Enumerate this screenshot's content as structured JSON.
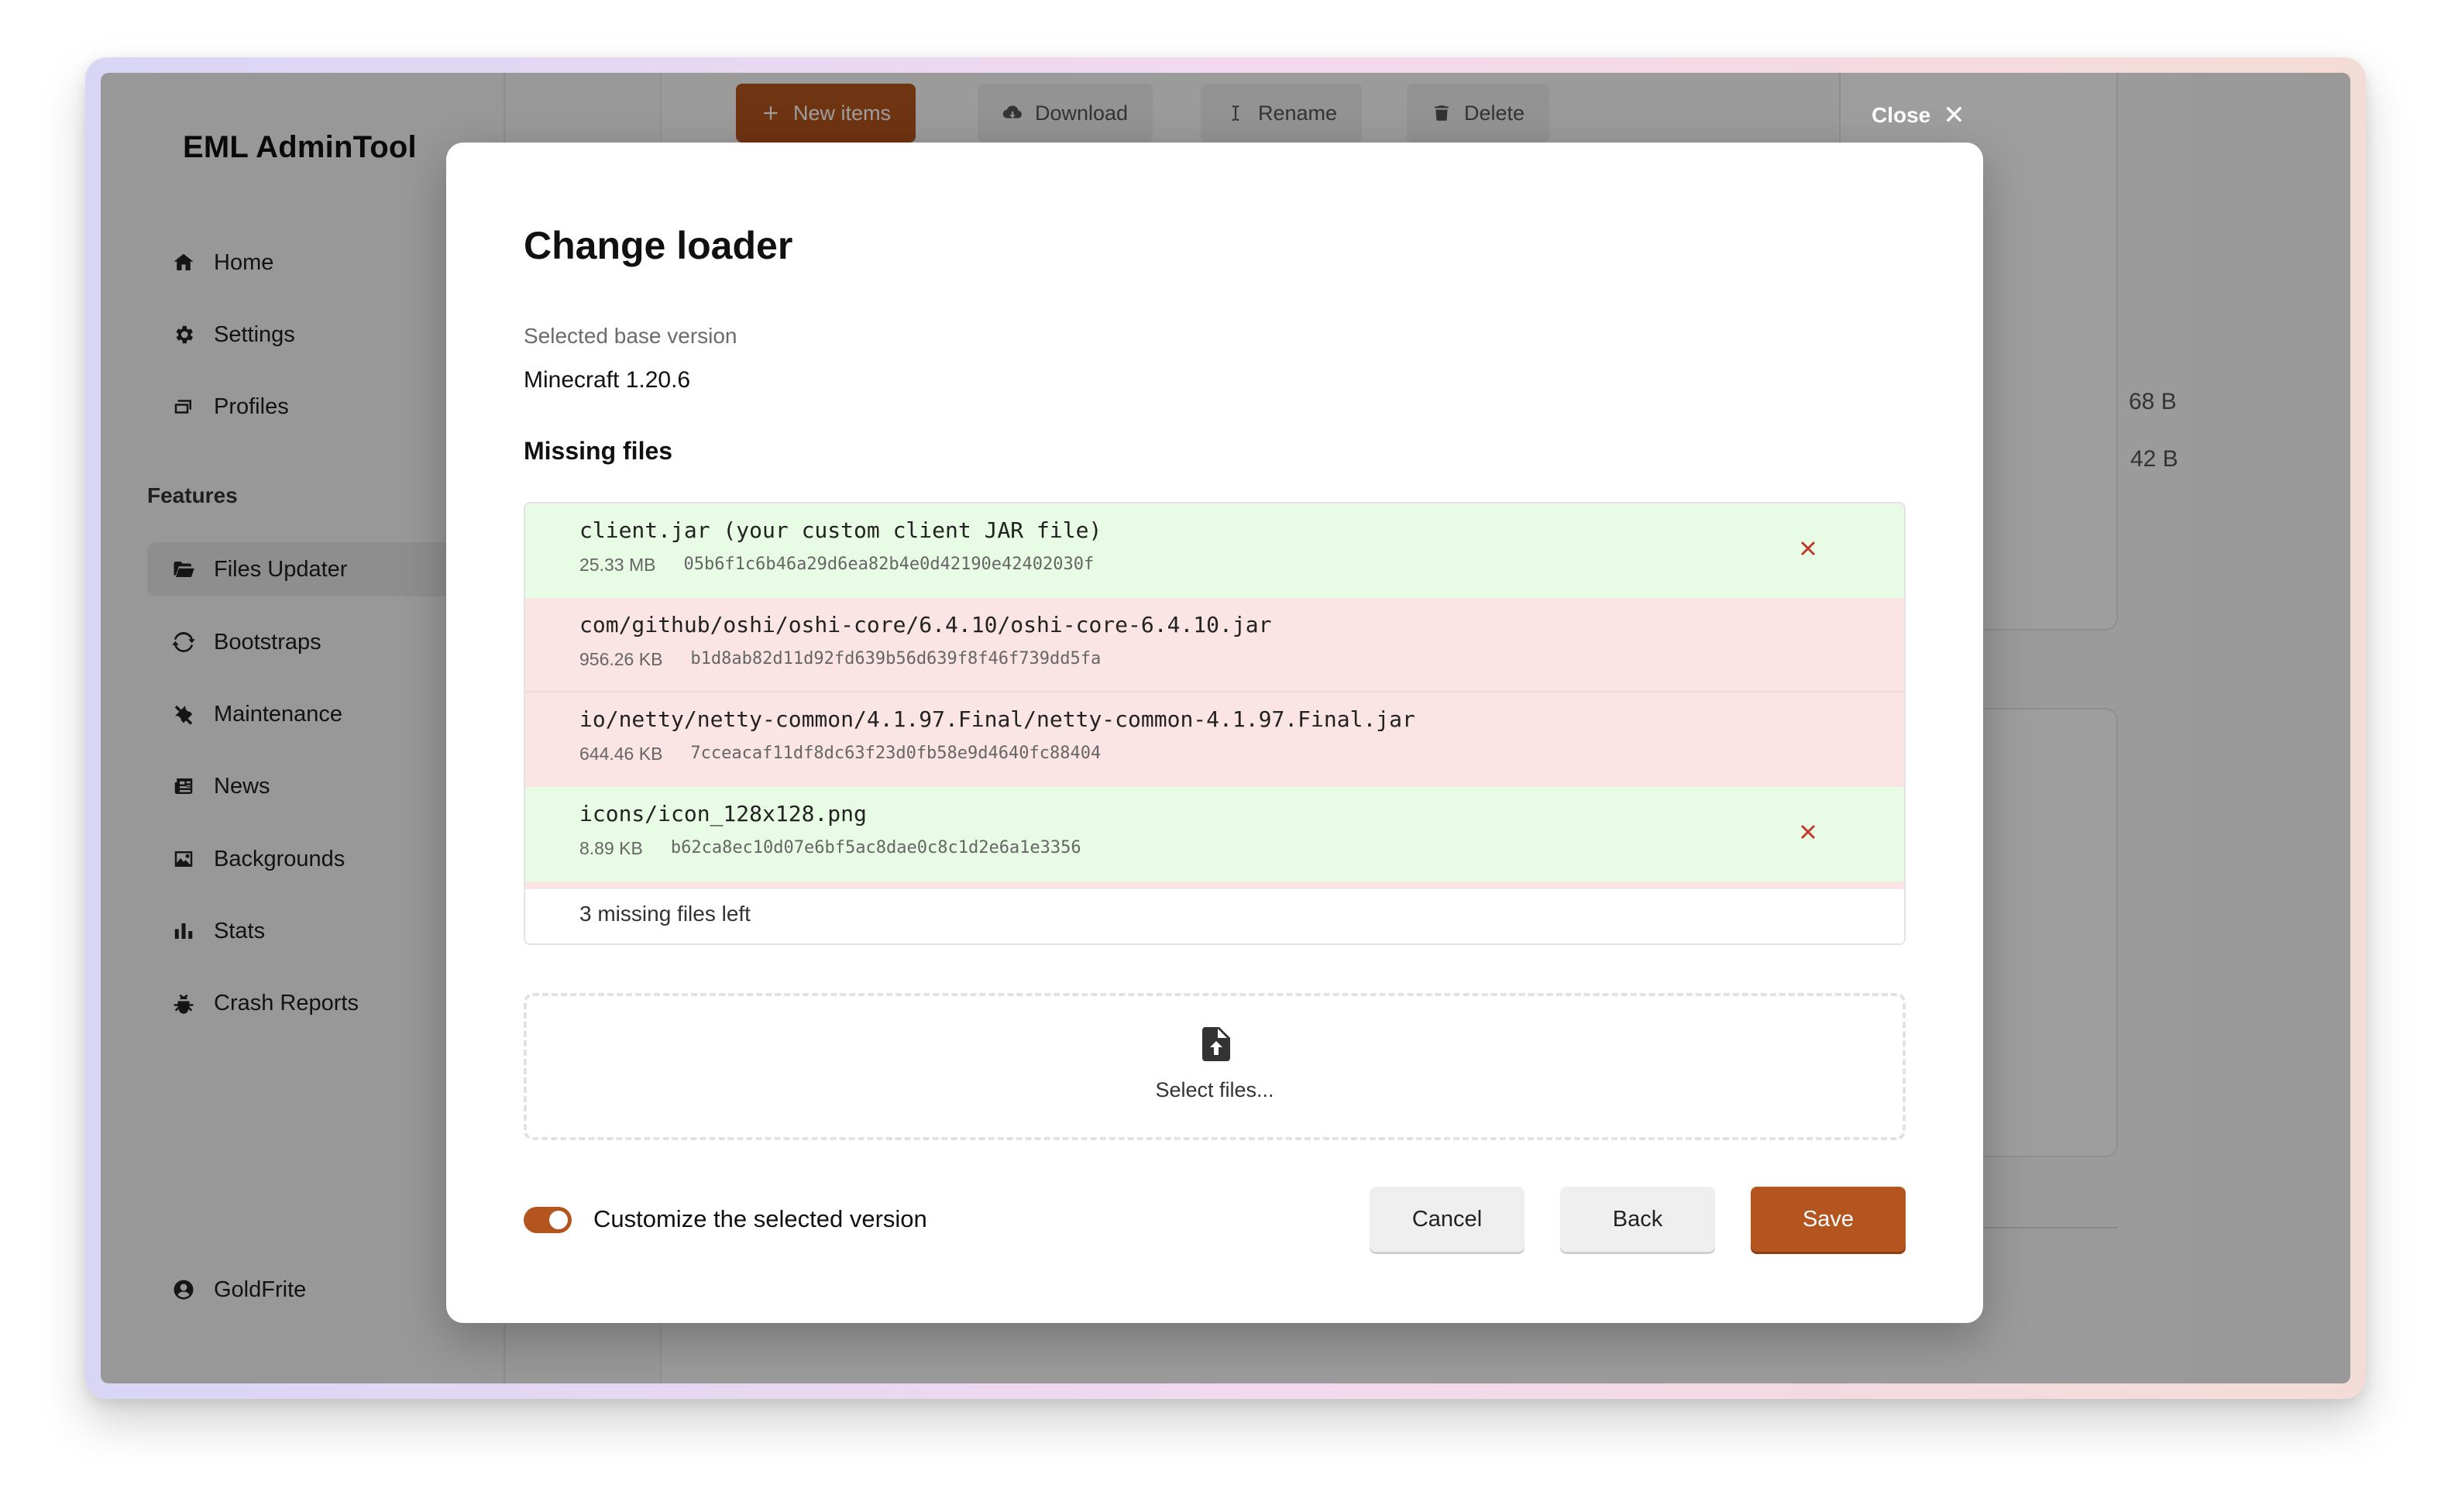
{
  "sidebar": {
    "app_title": "EML AdminTool",
    "nav": [
      {
        "label": "Home",
        "icon": "home-icon"
      },
      {
        "label": "Settings",
        "icon": "gear-icon"
      },
      {
        "label": "Profiles",
        "icon": "profiles-icon"
      }
    ],
    "features_label": "Features",
    "features": [
      {
        "label": "Files Updater",
        "icon": "folder-open-icon",
        "active": true
      },
      {
        "label": "Bootstraps",
        "icon": "refresh-icon"
      },
      {
        "label": "Maintenance",
        "icon": "tools-icon"
      },
      {
        "label": "News",
        "icon": "newspaper-icon"
      },
      {
        "label": "Backgrounds",
        "icon": "image-icon"
      },
      {
        "label": "Stats",
        "icon": "bar-chart-icon"
      },
      {
        "label": "Crash Reports",
        "icon": "bug-icon"
      }
    ],
    "user": {
      "name": "GoldFrite",
      "icon": "user-circle-icon"
    }
  },
  "toolbar": {
    "new_items": "New items",
    "download": "Download",
    "rename": "Rename",
    "delete": "Delete"
  },
  "background_sizes": [
    "68 B",
    "42 B"
  ],
  "close_label": "Close",
  "modal": {
    "title": "Change loader",
    "base_version_label": "Selected base version",
    "base_version_value": "Minecraft 1.20.6",
    "missing_files_title": "Missing files",
    "files": [
      {
        "name": "client.jar (your custom client JAR file)",
        "size": "25.33 MB",
        "hash": "05b6f1c6b46a29d6ea82b4e0d42190e42402030f",
        "status": "provided"
      },
      {
        "name": "com/github/oshi/oshi-core/6.4.10/oshi-core-6.4.10.jar",
        "size": "956.26 KB",
        "hash": "b1d8ab82d11d92fd639b56d639f8f46f739dd5fa",
        "status": "missing"
      },
      {
        "name": "io/netty/netty-common/4.1.97.Final/netty-common-4.1.97.Final.jar",
        "size": "644.46 KB",
        "hash": "7cceacaf11df8dc63f23d0fb58e9d4640fc88404",
        "status": "missing"
      },
      {
        "name": "icons/icon_128x128.png",
        "size": "8.89 KB",
        "hash": "b62ca8ec10d07e6bf5ac8dae0c8c1d2e6a1e3356",
        "status": "provided"
      }
    ],
    "missing_left": "3 missing files left",
    "select_files": "Select files...",
    "customize_label": "Customize the selected version",
    "customize_enabled": true,
    "cancel": "Cancel",
    "back": "Back",
    "save": "Save"
  },
  "colors": {
    "accent": "#b4541e",
    "ok_row": "#e8fbe4",
    "missing_row": "#fae4e4",
    "remove_x": "#c0392b"
  }
}
